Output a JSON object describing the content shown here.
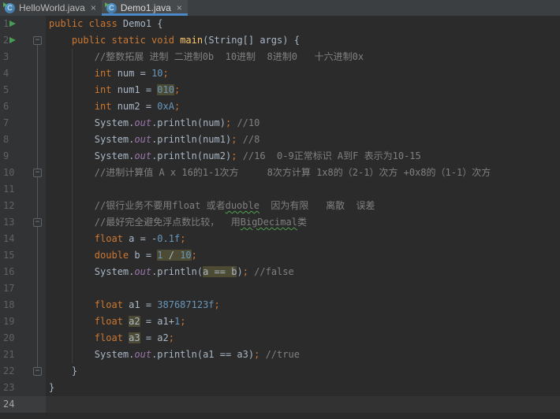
{
  "palette": {
    "editor_bg": "#2b2b2b",
    "gutter_bg": "#313335",
    "tabbar_bg": "#3c3f41",
    "active_tab_bg": "#474a4c",
    "active_tab_underline": "#4a88c7",
    "keyword": "#cc7832",
    "number": "#6897bb",
    "comment": "#808080",
    "static_field": "#9876aa",
    "method_decl": "#ffc66b",
    "text": "#a9b7c6",
    "line_number": "#606366",
    "highlight_bg": "#4e4b35",
    "run_icon": "#499c54",
    "caret_line_bg": "#323232",
    "squiggle": "#4da34d"
  },
  "tabs": [
    {
      "label": "HelloWorld.java",
      "close": "×",
      "icon_letter": "C",
      "active": false
    },
    {
      "label": "Demo1.java",
      "close": "×",
      "icon_letter": "C",
      "active": true
    }
  ],
  "editor": {
    "fold_glyph": "−",
    "lines": [
      {
        "no": "1",
        "run": true,
        "segs": [
          {
            "t": "public class ",
            "c": "kw"
          },
          {
            "t": "Demo1 {"
          }
        ]
      },
      {
        "no": "2",
        "run": true,
        "fold": "start",
        "segs": [
          {
            "t": "    "
          },
          {
            "t": "public static void ",
            "c": "kw"
          },
          {
            "t": "main",
            "c": "mth"
          },
          {
            "t": "(String[] args) {"
          }
        ]
      },
      {
        "no": "3",
        "segs": [
          {
            "t": "        "
          },
          {
            "t": "//整数拓展 进制 二进制0b  10进制  8进制0   十六进制0x",
            "c": "cmt"
          }
        ]
      },
      {
        "no": "4",
        "segs": [
          {
            "t": "        "
          },
          {
            "t": "int",
            "c": "kw"
          },
          {
            "t": " num = "
          },
          {
            "t": "10",
            "c": "num"
          },
          {
            "t": ";",
            "c": "semi"
          }
        ]
      },
      {
        "no": "5",
        "segs": [
          {
            "t": "        "
          },
          {
            "t": "int",
            "c": "kw"
          },
          {
            "t": " num1 = "
          },
          {
            "t": "010",
            "c": "num",
            "b": 1
          },
          {
            "t": ";",
            "c": "semi"
          }
        ]
      },
      {
        "no": "6",
        "segs": [
          {
            "t": "        "
          },
          {
            "t": "int",
            "c": "kw"
          },
          {
            "t": " num2 = "
          },
          {
            "t": "0xA",
            "c": "num"
          },
          {
            "t": ";",
            "c": "semi"
          }
        ]
      },
      {
        "no": "7",
        "segs": [
          {
            "t": "        "
          },
          {
            "t": "System."
          },
          {
            "t": "out",
            "c": "fld"
          },
          {
            "t": ".println(num)"
          },
          {
            "t": ";",
            "c": "semi"
          },
          {
            "t": " "
          },
          {
            "t": "//10",
            "c": "cmt"
          }
        ]
      },
      {
        "no": "8",
        "segs": [
          {
            "t": "        "
          },
          {
            "t": "System."
          },
          {
            "t": "out",
            "c": "fld"
          },
          {
            "t": ".println(num1)"
          },
          {
            "t": ";",
            "c": "semi"
          },
          {
            "t": " "
          },
          {
            "t": "//8",
            "c": "cmt"
          }
        ]
      },
      {
        "no": "9",
        "segs": [
          {
            "t": "        "
          },
          {
            "t": "System."
          },
          {
            "t": "out",
            "c": "fld"
          },
          {
            "t": ".println(num2)"
          },
          {
            "t": ";",
            "c": "semi"
          },
          {
            "t": " "
          },
          {
            "t": "//16  0-9正常标识 A到F 表示为10-15",
            "c": "cmt"
          }
        ]
      },
      {
        "no": "10",
        "fold": "mid",
        "segs": [
          {
            "t": "        "
          },
          {
            "t": "//进制计算值 A x 16的1-1次方     8次方计算 1x8的（2-1）次方 +0x8的（1-1）次方",
            "c": "cmt"
          }
        ]
      },
      {
        "no": "11",
        "segs": []
      },
      {
        "no": "12",
        "segs": [
          {
            "t": "        "
          },
          {
            "t": "//银行业务不要用float 或者",
            "c": "cmt"
          },
          {
            "t": "duoble",
            "c": "cmt",
            "w": 1
          },
          {
            "t": "  因为有限   离散  误差",
            "c": "cmt"
          }
        ]
      },
      {
        "no": "13",
        "fold": "mid",
        "segs": [
          {
            "t": "        "
          },
          {
            "t": "//最好完全避免浮点数比较，  用",
            "c": "cmt"
          },
          {
            "t": "BigDecimal",
            "c": "cmt",
            "w": 1
          },
          {
            "t": "类",
            "c": "cmt"
          }
        ]
      },
      {
        "no": "14",
        "segs": [
          {
            "t": "        "
          },
          {
            "t": "float",
            "c": "kw"
          },
          {
            "t": " a = -"
          },
          {
            "t": "0.1f",
            "c": "num"
          },
          {
            "t": ";",
            "c": "semi"
          }
        ]
      },
      {
        "no": "15",
        "segs": [
          {
            "t": "        "
          },
          {
            "t": "double",
            "c": "kw"
          },
          {
            "t": " b = "
          },
          {
            "t": "1",
            "c": "num",
            "b": 1
          },
          {
            "t": " / ",
            "b": 1
          },
          {
            "t": "10",
            "c": "num",
            "b": 1
          },
          {
            "t": ";",
            "c": "semi"
          }
        ]
      },
      {
        "no": "16",
        "segs": [
          {
            "t": "        "
          },
          {
            "t": "System."
          },
          {
            "t": "out",
            "c": "fld"
          },
          {
            "t": ".println("
          },
          {
            "t": "a == b",
            "b": 1
          },
          {
            "t": ")"
          },
          {
            "t": ";",
            "c": "semi"
          },
          {
            "t": " "
          },
          {
            "t": "//false",
            "c": "cmt"
          }
        ]
      },
      {
        "no": "17",
        "segs": []
      },
      {
        "no": "18",
        "segs": [
          {
            "t": "        "
          },
          {
            "t": "float",
            "c": "kw"
          },
          {
            "t": " a1 = "
          },
          {
            "t": "387687123f",
            "c": "num"
          },
          {
            "t": ";",
            "c": "semi"
          }
        ]
      },
      {
        "no": "19",
        "segs": [
          {
            "t": "        "
          },
          {
            "t": "float",
            "c": "kw"
          },
          {
            "t": " "
          },
          {
            "t": "a2",
            "b": 1
          },
          {
            "t": " = a1+"
          },
          {
            "t": "1",
            "c": "num"
          },
          {
            "t": ";",
            "c": "semi"
          }
        ]
      },
      {
        "no": "20",
        "segs": [
          {
            "t": "        "
          },
          {
            "t": "float",
            "c": "kw"
          },
          {
            "t": " "
          },
          {
            "t": "a3",
            "b": 1
          },
          {
            "t": " = a2"
          },
          {
            "t": ";",
            "c": "semi"
          }
        ]
      },
      {
        "no": "21",
        "segs": [
          {
            "t": "        "
          },
          {
            "t": "System."
          },
          {
            "t": "out",
            "c": "fld"
          },
          {
            "t": ".println(a1 == a3)"
          },
          {
            "t": ";",
            "c": "semi"
          },
          {
            "t": " "
          },
          {
            "t": "//true",
            "c": "cmt"
          }
        ]
      },
      {
        "no": "22",
        "fold": "end",
        "segs": [
          {
            "t": "    }"
          }
        ]
      },
      {
        "no": "23",
        "segs": [
          {
            "t": "}"
          }
        ]
      },
      {
        "no": "24",
        "caret": true,
        "segs": []
      }
    ]
  }
}
